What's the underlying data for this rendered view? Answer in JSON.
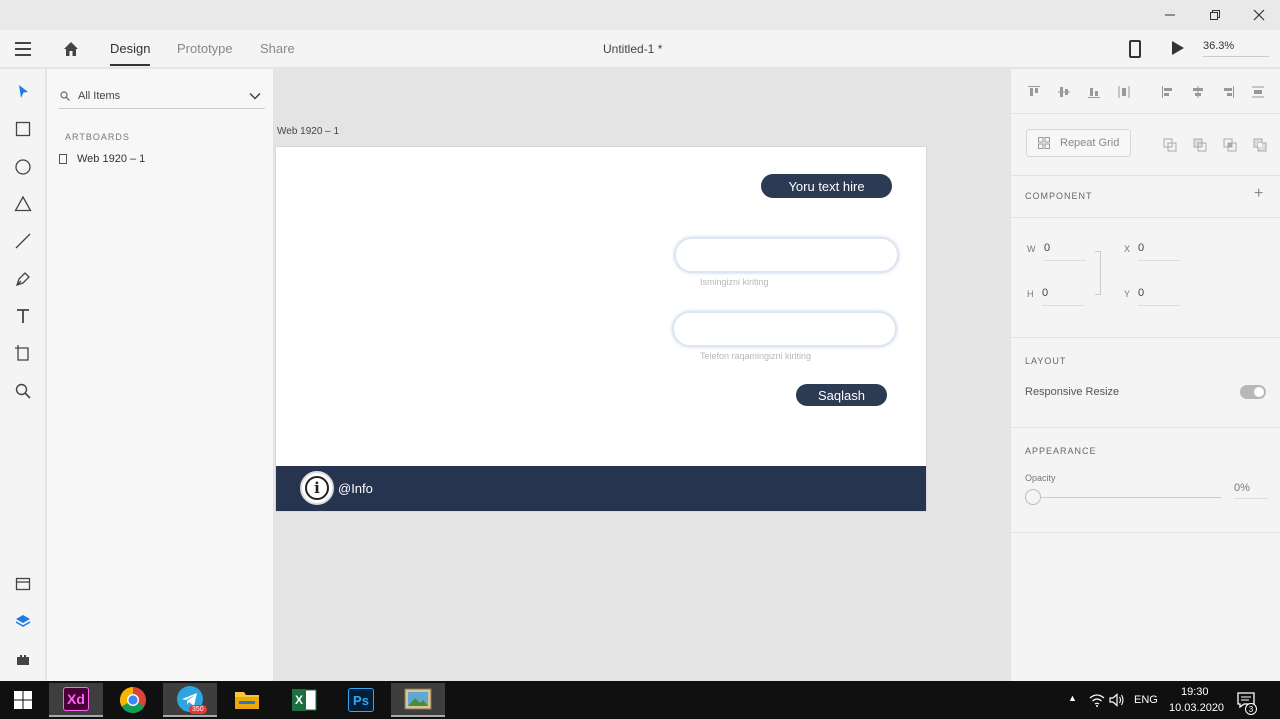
{
  "window": {
    "controls": [
      "minimize",
      "restore",
      "close"
    ]
  },
  "appbar": {
    "tabs": [
      "Design",
      "Prototype",
      "Share"
    ],
    "active_tab": "Design",
    "doc_title": "Untitled-1 *",
    "zoom": "36.3%"
  },
  "layers": {
    "search_label": "All Items",
    "section_title": "ARTBOARDS",
    "items": [
      "Web 1920 – 1"
    ]
  },
  "canvas": {
    "artboard_label": "Web 1920 – 1",
    "top_button": "Yoru text hire",
    "name_hint": "Ismingizni kiriting",
    "phone_hint": "Telefon raqamingizni kiriting",
    "save_button": "Saqlash",
    "footer_text": "@Info",
    "colors": {
      "dark": "#2d3a54",
      "footer": "#273450"
    }
  },
  "props": {
    "repeat_grid": "Repeat Grid",
    "component_title": "COMPONENT",
    "w_label": "W",
    "w_value": "0",
    "h_label": "H",
    "h_value": "0",
    "x_label": "X",
    "x_value": "0",
    "y_label": "Y",
    "y_value": "0",
    "layout_title": "LAYOUT",
    "responsive_label": "Responsive Resize",
    "appearance_title": "APPEARANCE",
    "opacity_label": "Opacity",
    "opacity_value": "0%"
  },
  "taskbar": {
    "apps": [
      "Xd",
      "Chrome",
      "Telegram",
      "File Explorer",
      "Excel",
      "Ps",
      "Photos"
    ],
    "telegram_badge": "350",
    "language": "ENG",
    "time": "19:30",
    "date": "10.03.2020",
    "notification_count": "3"
  }
}
